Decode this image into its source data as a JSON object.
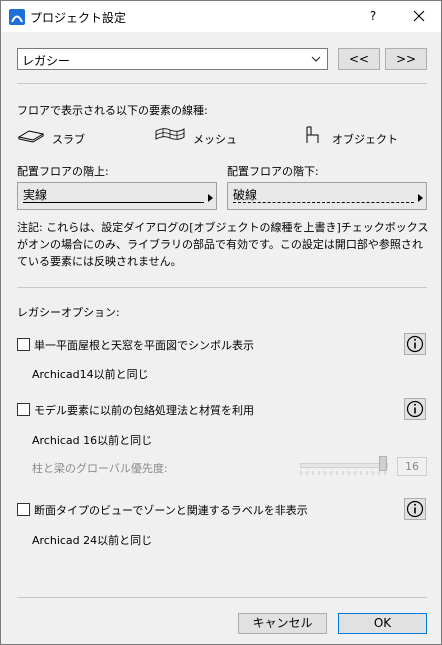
{
  "window": {
    "title": "プロジェクト設定",
    "help_label": "?"
  },
  "preset": {
    "selected": "レガシー",
    "prev_label": "<<",
    "next_label": ">>"
  },
  "floor_lines": {
    "heading": "フロアで表示される以下の要素の線種:",
    "types": [
      "スラブ",
      "メッシュ",
      "オブジェクト"
    ],
    "above_label": "配置フロアの階上:",
    "above_value": "実線",
    "below_label": "配置フロアの階下:",
    "below_value": "破線"
  },
  "note": "注記: これらは、設定ダイアログの[オブジェクトの線種を上書き]チェックボックスがオンの場合にのみ、ライブラリの部品で有効です。この設定は開口部や参照されている要素には反映されません。",
  "legacy": {
    "heading": "レガシーオプション:",
    "option1": {
      "label": "単一平面屋根と天窓を平面図でシンボル表示",
      "sub": "Archicad14以前と同じ",
      "checked": false
    },
    "option2": {
      "label": "モデル要素に以前の包絡処理法と材質を利用",
      "sub": "Archicad 16以前と同じ",
      "checked": false
    },
    "priority": {
      "label": "柱と梁のグローバル優先度:",
      "value": "16"
    },
    "option3": {
      "label": "断面タイプのビューでゾーンと関連するラベルを非表示",
      "sub": "Archicad 24以前と同じ",
      "checked": false
    }
  },
  "footer": {
    "cancel_label": "キャンセル",
    "ok_label": "OK"
  },
  "colors": {
    "accent": "#1e6fd6",
    "primary_border": "#0078d7"
  }
}
